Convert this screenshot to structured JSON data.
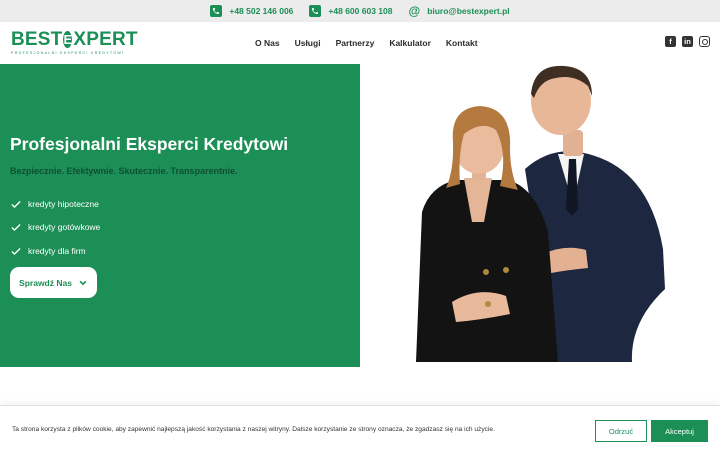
{
  "topbar": {
    "phone1": "+48 502 146 006",
    "phone2": "+48 600 603 108",
    "email": "biuro@bestexpert.pl"
  },
  "logo": {
    "text_before": "BEST",
    "text_e": "E",
    "text_after": "XPERT",
    "subtitle": "PROFESJONALNI EKSPERCI KREDYTOWI"
  },
  "nav": {
    "items": [
      "O Nas",
      "Usługi",
      "Partnerzy",
      "Kalkulator",
      "Kontakt"
    ]
  },
  "social": {
    "icons": [
      "facebook-icon",
      "linkedin-icon",
      "instagram-icon"
    ]
  },
  "hero": {
    "title": "Profesjonalni Eksperci Kredytowi",
    "tagline": "Bezpiecznie. Efektywnie. Skutecznie. Transparentnie.",
    "features": [
      "kredyty hipoteczne",
      "kredyty gotówkowe",
      "kredyty dla firm"
    ],
    "cta_label": "Sprawdź Nas"
  },
  "cookie": {
    "text": "Ta strona korzysta z plików cookie, aby zapewnić najlepszą jakość korzystania z naszej witryny. Dalsze korzystanie ze strony oznacza, że zgadzasz się na ich użycie.",
    "reject_label": "Odrzuć",
    "accept_label": "Akceptuj"
  },
  "colors": {
    "brand": "#1c8f57",
    "tagline": "#0e4f30",
    "topbar_bg": "#ececec"
  }
}
